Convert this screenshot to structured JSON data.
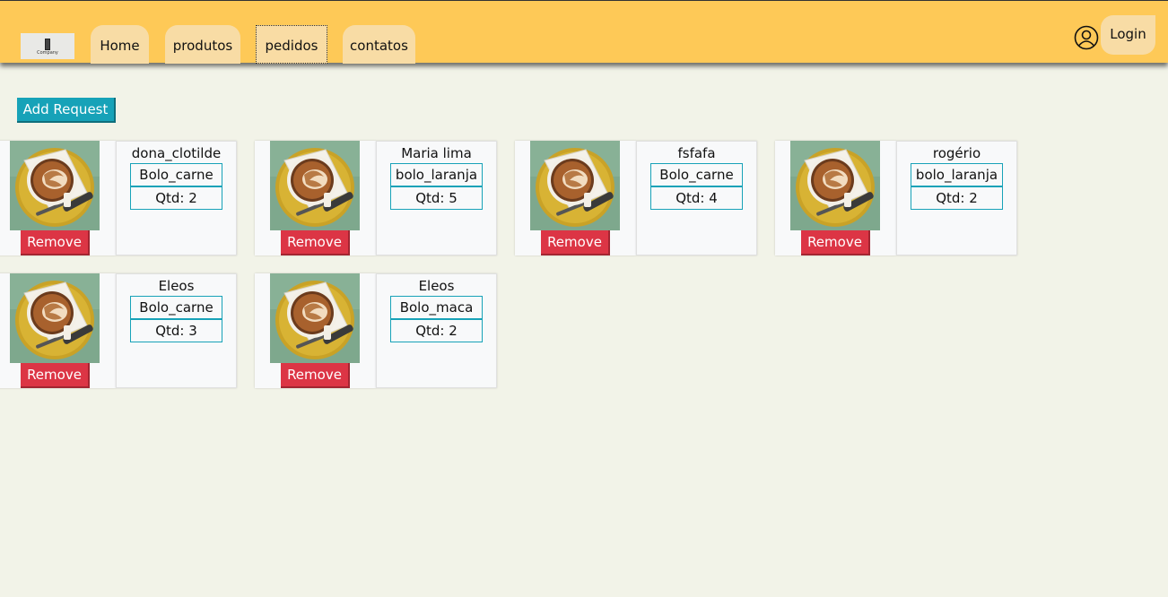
{
  "header": {
    "logo_text": "Company",
    "nav": [
      "Home",
      "produtos",
      "pedidos",
      "contatos"
    ],
    "active_tab": "pedidos",
    "login_label": "Login"
  },
  "actions": {
    "add_request_label": "Add Request",
    "remove_label": "Remove"
  },
  "orders": [
    {
      "customer": "dona_clotilde",
      "product": "Bolo_carne",
      "qty": "Qtd: 2"
    },
    {
      "customer": "Maria lima",
      "product": "bolo_laranja",
      "qty": "Qtd: 5"
    },
    {
      "customer": "fsfafa",
      "product": "Bolo_carne",
      "qty": "Qtd: 4"
    },
    {
      "customer": "rogério",
      "product": "bolo_laranja",
      "qty": "Qtd: 2"
    },
    {
      "customer": "Eleos",
      "product": "Bolo_carne",
      "qty": "Qtd: 3"
    },
    {
      "customer": "Eleos",
      "product": "Bolo_maca",
      "qty": "Qtd: 2"
    }
  ],
  "colors": {
    "header_bg": "#fec957",
    "tab_bg": "#f8dca5",
    "page_bg": "#f2f3e8",
    "add_button": "#17a2b8",
    "remove_button": "#dc3545",
    "field_border": "#17a2b8"
  },
  "icons": {
    "user": "user-circle-icon",
    "order_image": "coffee-cup-image"
  }
}
